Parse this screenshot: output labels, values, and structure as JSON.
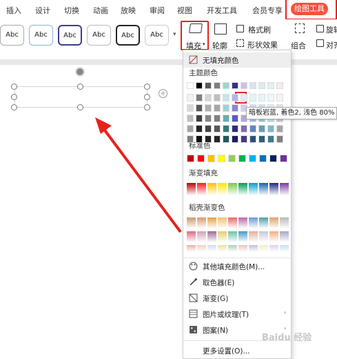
{
  "tabs": [
    "插入",
    "设计",
    "切换",
    "动画",
    "放映",
    "审阅",
    "视图",
    "开发工具",
    "会员专享"
  ],
  "active_tab": "绘图工具",
  "style_buttons": [
    "Abc",
    "Abc",
    "Abc",
    "Abc",
    "Abc",
    "Abc"
  ],
  "ribbon": {
    "fill": "填充",
    "outline": "轮廓",
    "format_brush": "格式刷",
    "shape_effect": "形状效果",
    "combine": "组合",
    "rotate": "旋转",
    "align": "对齐"
  },
  "menu": {
    "no_fill": "无填充颜色",
    "theme_colors": "主题颜色",
    "standard_colors": "标准色",
    "gradient_fill": "渐变填充",
    "shell_gradient": "稻壳渐变色",
    "more_colors": "其他填充颜色(M)...",
    "eyedropper": "取色器(E)",
    "gradient": "渐变(G)",
    "picture_texture": "图片或纹理(T)",
    "pattern": "图案(N)",
    "more_settings": "更多设置(O)..."
  },
  "tooltip": "暗板岩蓝, 着色2, 浅色 80%",
  "watermark": "Baidu 经验",
  "colors": {
    "theme_top": [
      "#ffffff",
      "#000000",
      "#44546a",
      "#4472c4",
      "#a5c7de",
      "#2e3192",
      "#e7e6e6",
      "#d9d9d9",
      "#ffffff",
      "#dde4f2",
      "#dbe9f3",
      "#bcd4e9",
      "#d0cbe9"
    ],
    "theme_cols": [
      "#f2f2f2",
      "#7f7f7f",
      "#d6dce4",
      "#a6c8e0",
      "#9fd3cf",
      "#b4a7d6",
      "#ebebeb",
      "#dde8f0",
      "#d5eef0",
      "#c9c3e6",
      "#efefef",
      "#f0f0f0",
      "#e1f0f5"
    ],
    "standard": [
      "#c00000",
      "#ff0000",
      "#ffc000",
      "#ffff00",
      "#92d050",
      "#00b050",
      "#00b0f0",
      "#0070c0",
      "#002060",
      "#7030a0"
    ],
    "gradient": [
      "#c00000",
      "#ff1a1a",
      "#ffc000",
      "#ffe600",
      "#7ec850",
      "#00a050",
      "#00a0d0",
      "#1064b0",
      "#1a2a80",
      "#7a3aa0"
    ],
    "accent_red": "#e8211a",
    "active_tab_bg": "#f5523c"
  }
}
